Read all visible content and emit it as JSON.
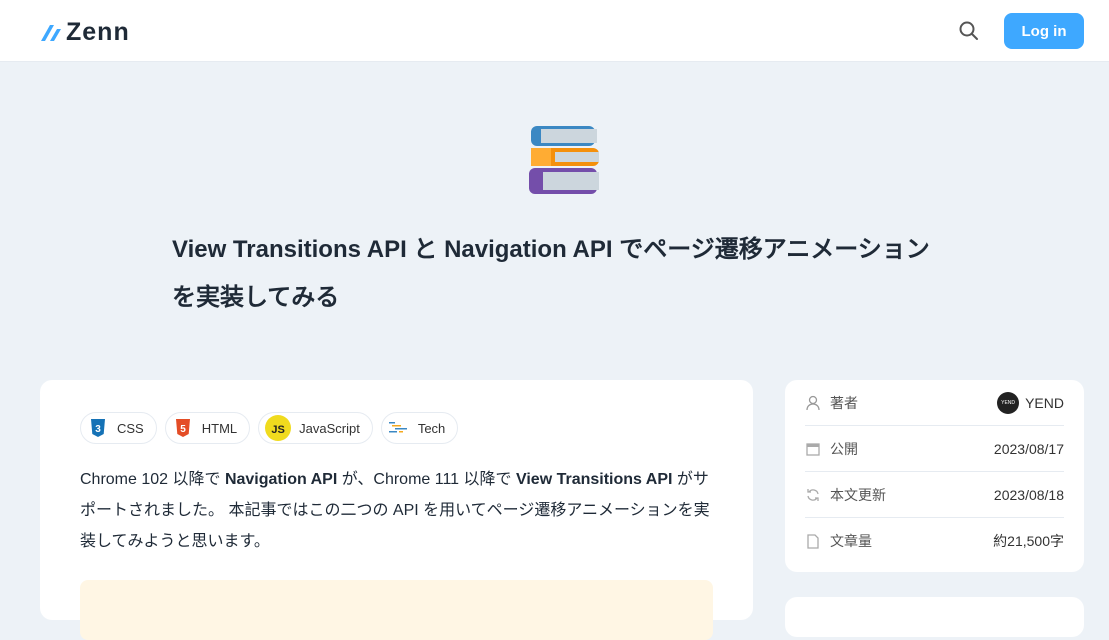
{
  "header": {
    "logo": "Zenn",
    "login_label": "Log in"
  },
  "article": {
    "emoji": "books",
    "title": "View Transitions API と Navigation API でページ遷移アニメーションを実装してみる",
    "tags": [
      {
        "label": "CSS",
        "icon": "css3-icon"
      },
      {
        "label": "HTML",
        "icon": "html5-icon"
      },
      {
        "label": "JavaScript",
        "icon": "javascript-icon"
      },
      {
        "label": "Tech",
        "icon": "tech-icon"
      }
    ],
    "body": {
      "p1": "Chrome 102 以降で ",
      "b1": "Navigation API",
      "p2": " が、Chrome 111 以降で ",
      "b2": "View Transitions API",
      "p3": " がサポートされました。 本記事ではこの二つの API を用いてページ遷移アニメーションを実装してみようと思います。"
    }
  },
  "sidebar": {
    "author_label": "著者",
    "author_name": "YEND",
    "avatar_text": "YEND",
    "published_label": "公開",
    "published": "2023/08/17",
    "updated_label": "本文更新",
    "updated": "2023/08/18",
    "length_label": "文章量",
    "length": "約21,500字"
  },
  "colors": {
    "accent": "#3ea8ff",
    "background": "#edf2f7"
  }
}
